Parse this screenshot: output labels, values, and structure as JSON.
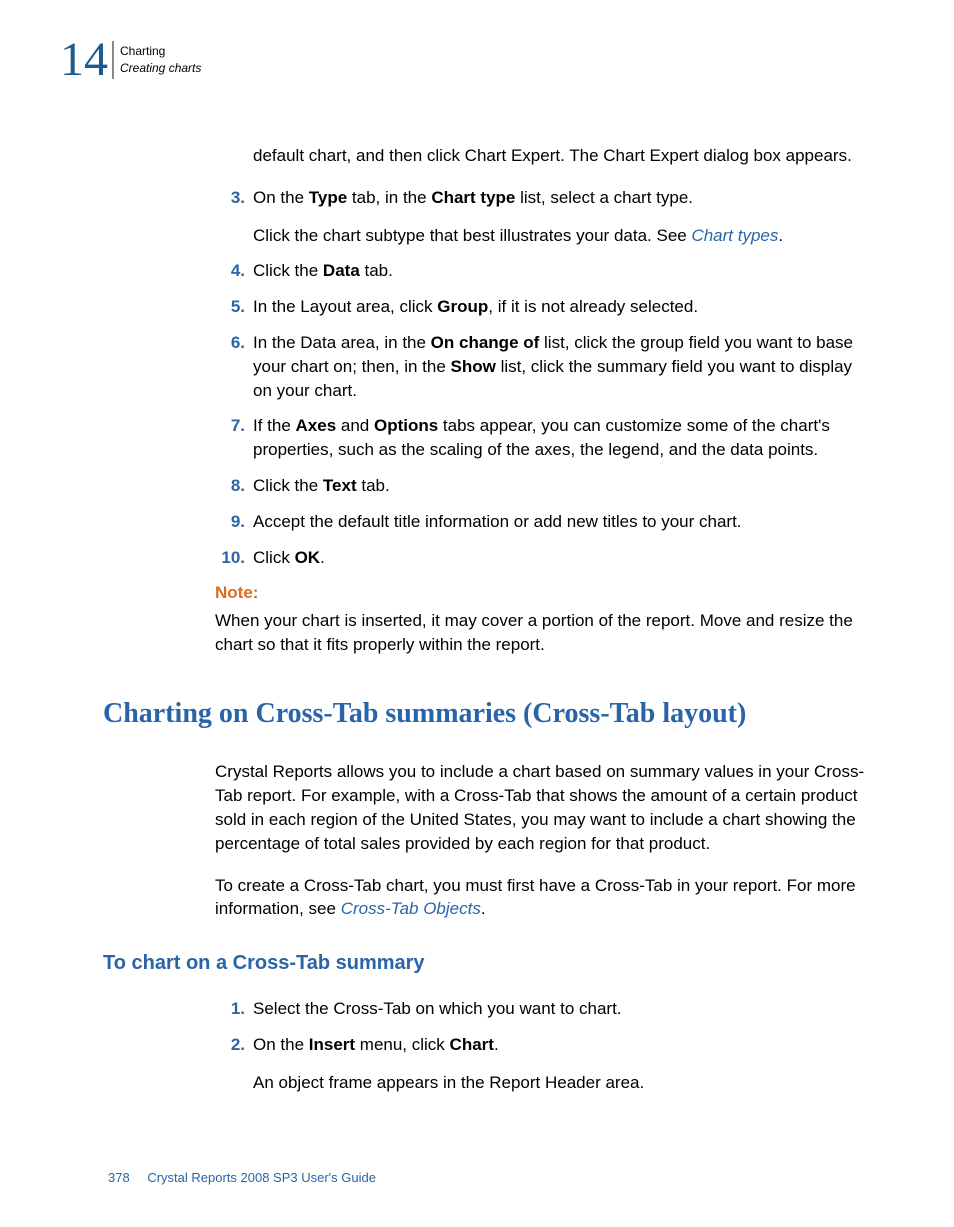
{
  "header": {
    "chapter_number": "14",
    "top": "Charting",
    "bottom": "Creating charts"
  },
  "intro": {
    "continuation": "default chart, and then click Chart Expert. The Chart Expert dialog box appears."
  },
  "steps": {
    "s3": {
      "num": "3.",
      "pre": "On the ",
      "b1": "Type",
      "mid1": " tab, in the ",
      "b2": "Chart type",
      "post1": " list, select a chart type.",
      "sub_pre": "Click the chart subtype that best illustrates your data. See ",
      "sub_link": "Chart types",
      "sub_post": "."
    },
    "s4": {
      "num": "4.",
      "pre": "Click the ",
      "b1": "Data",
      "post": " tab."
    },
    "s5": {
      "num": "5.",
      "pre": "In the Layout area, click ",
      "b1": "Group",
      "post": ", if it is not already selected."
    },
    "s6": {
      "num": "6.",
      "pre": "In the Data area, in the ",
      "b1": "On change of",
      "mid1": " list, click the group field you want to base your chart on; then, in the ",
      "b2": "Show",
      "post": " list, click the summary field you want to display on your chart."
    },
    "s7": {
      "num": "7.",
      "pre": "If the ",
      "b1": "Axes",
      "mid1": " and ",
      "b2": "Options",
      "post": " tabs appear, you can customize some of the chart's properties, such as the scaling of the axes, the legend, and the data points."
    },
    "s8": {
      "num": "8.",
      "pre": "Click the ",
      "b1": "Text",
      "post": " tab."
    },
    "s9": {
      "num": "9.",
      "text": "Accept the default title information or add new titles to your chart."
    },
    "s10": {
      "num": "10.",
      "pre": "Click ",
      "b1": "OK",
      "post": "."
    }
  },
  "note": {
    "label": "Note:",
    "text": "When your chart is inserted, it may cover a portion of the report. Move and resize the chart so that it fits properly within the report."
  },
  "h2": "Charting on Cross-Tab summaries (Cross-Tab layout)",
  "section2": {
    "p1": "Crystal Reports allows you to include a chart based on summary values in your Cross-Tab report. For example, with a Cross-Tab that shows the amount of a certain product sold in each region of the United States, you may want to include a chart showing the percentage of total sales provided by each region for that product.",
    "p2_pre": "To create a Cross-Tab chart, you must first have a Cross-Tab in your report. For more information, see ",
    "p2_link": "Cross-Tab Objects",
    "p2_post": "."
  },
  "h3": "To chart on a Cross-Tab summary",
  "steps2": {
    "s1": {
      "num": "1.",
      "text": "Select the Cross-Tab on which you want to chart."
    },
    "s2": {
      "num": "2.",
      "pre": "On the ",
      "b1": "Insert",
      "mid": " menu, click ",
      "b2": "Chart",
      "post": ".",
      "sub": "An object frame appears in the Report Header area."
    }
  },
  "footer": {
    "page": "378",
    "title": "Crystal Reports 2008 SP3 User's Guide"
  }
}
